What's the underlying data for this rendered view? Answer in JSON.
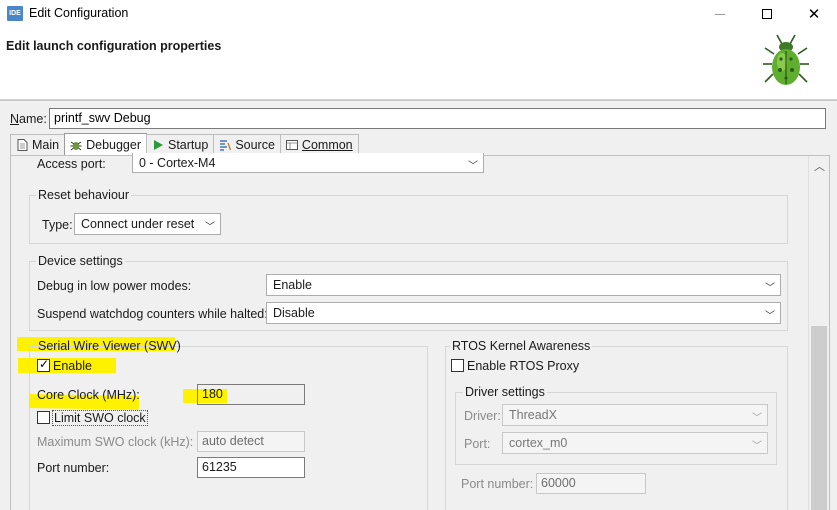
{
  "window": {
    "icon_text": "IDE",
    "title": "Edit Configuration",
    "controls": {
      "minimize": "—",
      "maximize": "☐",
      "close": "✕"
    }
  },
  "banner": {
    "title": "Edit launch configuration properties"
  },
  "name_field": {
    "label_prefix": "N",
    "label_rest": "ame:",
    "value": "printf_swv Debug"
  },
  "tabs": [
    {
      "label": "Main",
      "icon": "main-tab-icon",
      "active": false
    },
    {
      "label": "Debugger",
      "icon": "debugger-tab-icon",
      "active": true
    },
    {
      "label": "Startup",
      "icon": "startup-tab-icon",
      "active": false
    },
    {
      "label": "Source",
      "icon": "source-tab-icon",
      "active": false
    },
    {
      "label": "Common",
      "icon": "common-tab-icon",
      "active": false
    }
  ],
  "access_port": {
    "label": "Access port:",
    "value": "0 - Cortex-M4"
  },
  "reset_behaviour": {
    "title": "Reset behaviour",
    "type_label": "Type:",
    "type_value": "Connect under reset"
  },
  "device_settings": {
    "title": "Device settings",
    "low_power_label": "Debug in low power modes:",
    "low_power_value": "Enable",
    "watchdog_label": "Suspend watchdog counters while halted:",
    "watchdog_value": "Disable"
  },
  "swv": {
    "title": "Serial Wire Viewer (SWV)",
    "enable_label": "Enable",
    "enable_checked": true,
    "core_clock_label": "Core Clock (MHz):",
    "core_clock_value": "180",
    "limit_swo_label": "Limit SWO clock",
    "limit_swo_checked": false,
    "max_swo_label": "Maximum SWO clock (kHz):",
    "max_swo_value": "auto detect",
    "port_label": "Port number:",
    "port_value": "61235"
  },
  "rtos": {
    "title": "RTOS Kernel Awareness",
    "enable_proxy_label": "Enable RTOS Proxy",
    "enable_proxy_checked": false,
    "driver_settings_title": "Driver settings",
    "driver_label": "Driver:",
    "driver_value": "ThreadX",
    "port_label": "Port:",
    "port_value": "cortex_m0",
    "port_number_label": "Port number:",
    "port_number_value": "60000"
  },
  "colors": {
    "highlight": "#fff200",
    "accent": "#4a86c8"
  }
}
